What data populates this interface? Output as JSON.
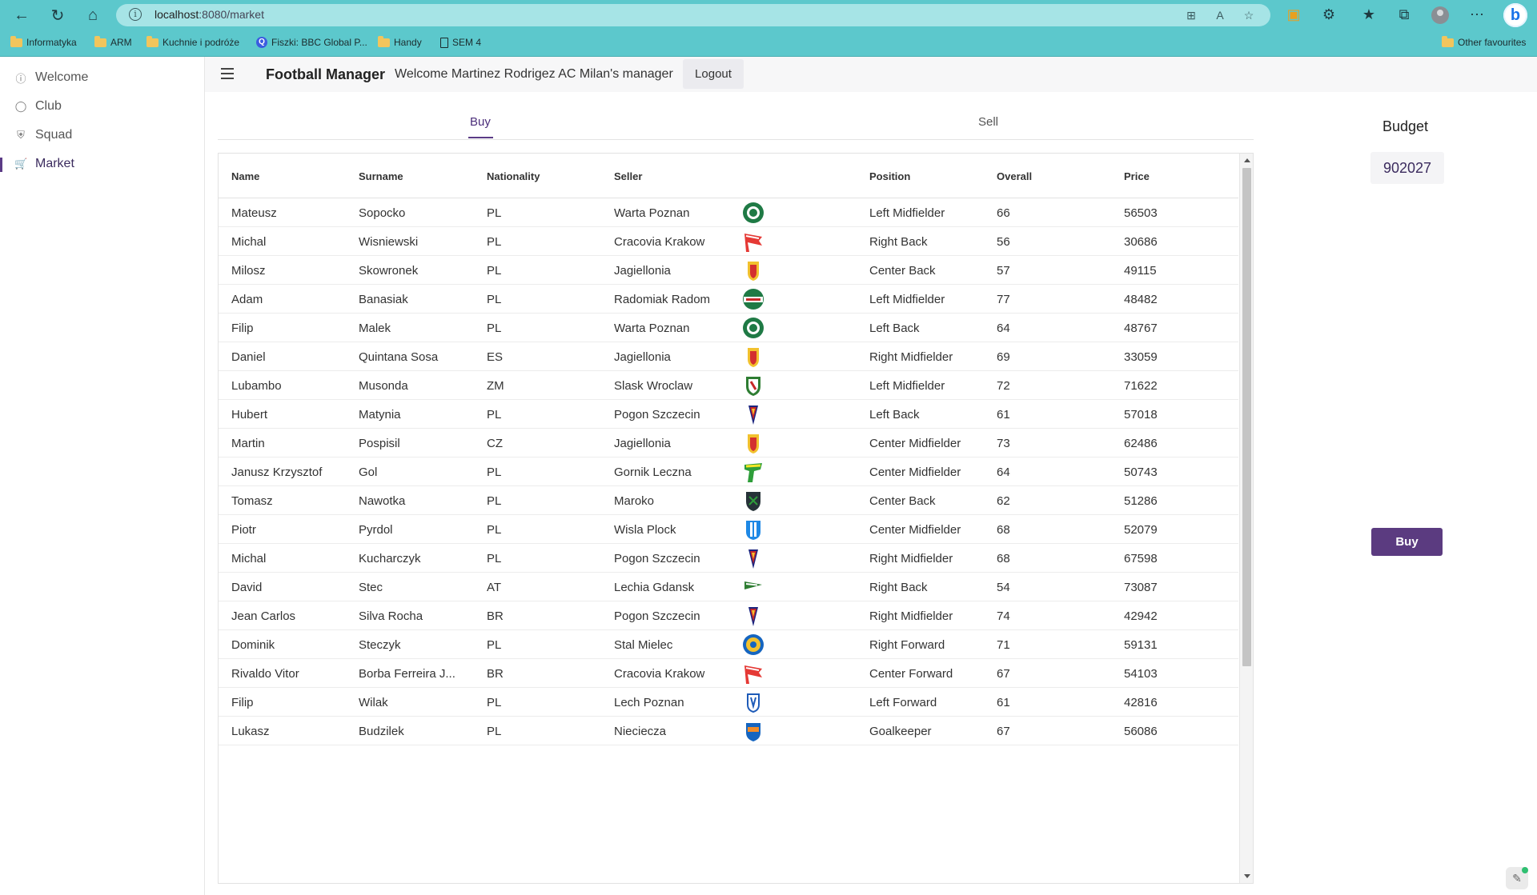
{
  "browser": {
    "url_host": "localhost",
    "url_path": ":8080/market",
    "bookmarks": [
      {
        "label": "Informatyka",
        "icon": "folder-icon"
      },
      {
        "label": "ARM",
        "icon": "folder-icon"
      },
      {
        "label": "Kuchnie i podróże",
        "icon": "folder-icon"
      },
      {
        "label": "Fiszki: BBC Global P...",
        "icon": "quizlet-icon"
      },
      {
        "label": "Handy",
        "icon": "folder-icon"
      },
      {
        "label": "SEM 4",
        "icon": "document-icon"
      }
    ],
    "other_favourites": "Other favourites",
    "colors": {
      "chrome": "#5cc8cc",
      "url_bar": "#a6e4e6"
    }
  },
  "sidebar": {
    "items": [
      {
        "label": "Welcome",
        "icon": "info-icon"
      },
      {
        "label": "Club",
        "icon": "lightbulb-icon"
      },
      {
        "label": "Squad",
        "icon": "shield-icon"
      },
      {
        "label": "Market",
        "icon": "cart-icon",
        "active": true
      }
    ]
  },
  "header": {
    "title": "Football Manager",
    "welcome": "Welcome Martinez Rodrigez AC Milan's manager",
    "logout": "Logout"
  },
  "tabs": {
    "buy": "Buy",
    "sell": "Sell",
    "active": "Buy"
  },
  "table": {
    "columns": [
      "Name",
      "Surname",
      "Nationality",
      "Seller",
      "Position",
      "Overall",
      "Price"
    ],
    "rows": [
      {
        "name": "Mateusz",
        "surname": "Sopocko",
        "nat": "PL",
        "seller": "Warta Poznan",
        "crest": "warta-crest-icon",
        "position": "Left Midfielder",
        "overall": "66",
        "price": "56503"
      },
      {
        "name": "Michal",
        "surname": "Wisniewski",
        "nat": "PL",
        "seller": "Cracovia Krakow",
        "crest": "cracovia-crest-icon",
        "position": "Right Back",
        "overall": "56",
        "price": "30686"
      },
      {
        "name": "Milosz",
        "surname": "Skowronek",
        "nat": "PL",
        "seller": "Jagiellonia",
        "crest": "jagiellonia-crest-icon",
        "position": "Center Back",
        "overall": "57",
        "price": "49115"
      },
      {
        "name": "Adam",
        "surname": "Banasiak",
        "nat": "PL",
        "seller": "Radomiak Radom",
        "crest": "radomiak-crest-icon",
        "position": "Left Midfielder",
        "overall": "77",
        "price": "48482"
      },
      {
        "name": "Filip",
        "surname": "Malek",
        "nat": "PL",
        "seller": "Warta Poznan",
        "crest": "warta-crest-icon",
        "position": "Left Back",
        "overall": "64",
        "price": "48767"
      },
      {
        "name": "Daniel",
        "surname": "Quintana Sosa",
        "nat": "ES",
        "seller": "Jagiellonia",
        "crest": "jagiellonia-crest-icon",
        "position": "Right Midfielder",
        "overall": "69",
        "price": "33059"
      },
      {
        "name": "Lubambo",
        "surname": "Musonda",
        "nat": "ZM",
        "seller": "Slask Wroclaw",
        "crest": "slask-crest-icon",
        "position": "Left Midfielder",
        "overall": "72",
        "price": "71622"
      },
      {
        "name": "Hubert",
        "surname": "Matynia",
        "nat": "PL",
        "seller": "Pogon Szczecin",
        "crest": "pogon-crest-icon",
        "position": "Left Back",
        "overall": "61",
        "price": "57018"
      },
      {
        "name": "Martin",
        "surname": "Pospisil",
        "nat": "CZ",
        "seller": "Jagiellonia",
        "crest": "jagiellonia-crest-icon",
        "position": "Center Midfielder",
        "overall": "73",
        "price": "62486"
      },
      {
        "name": "Janusz Krzysztof",
        "surname": "Gol",
        "nat": "PL",
        "seller": "Gornik Leczna",
        "crest": "gornik-leczna-crest-icon",
        "position": "Center Midfielder",
        "overall": "64",
        "price": "50743"
      },
      {
        "name": "Tomasz",
        "surname": "Nawotka",
        "nat": "PL",
        "seller": "Maroko",
        "crest": "maroko-crest-icon",
        "position": "Center Back",
        "overall": "62",
        "price": "51286"
      },
      {
        "name": "Piotr",
        "surname": "Pyrdol",
        "nat": "PL",
        "seller": "Wisla Plock",
        "crest": "wisla-plock-crest-icon",
        "position": "Center Midfielder",
        "overall": "68",
        "price": "52079"
      },
      {
        "name": "Michal",
        "surname": "Kucharczyk",
        "nat": "PL",
        "seller": "Pogon Szczecin",
        "crest": "pogon-crest-icon",
        "position": "Right Midfielder",
        "overall": "68",
        "price": "67598"
      },
      {
        "name": "David",
        "surname": "Stec",
        "nat": "AT",
        "seller": "Lechia Gdansk",
        "crest": "lechia-crest-icon",
        "position": "Right Back",
        "overall": "54",
        "price": "73087"
      },
      {
        "name": "Jean Carlos",
        "surname": "Silva Rocha",
        "nat": "BR",
        "seller": "Pogon Szczecin",
        "crest": "pogon-crest-icon",
        "position": "Right Midfielder",
        "overall": "74",
        "price": "42942"
      },
      {
        "name": "Dominik",
        "surname": "Steczyk",
        "nat": "PL",
        "seller": "Stal Mielec",
        "crest": "stal-mielec-crest-icon",
        "position": "Right Forward",
        "overall": "71",
        "price": "59131"
      },
      {
        "name": "Rivaldo Vitor",
        "surname": "Borba Ferreira J...",
        "nat": "BR",
        "seller": "Cracovia Krakow",
        "crest": "cracovia-crest-icon",
        "position": "Center Forward",
        "overall": "67",
        "price": "54103"
      },
      {
        "name": "Filip",
        "surname": "Wilak",
        "nat": "PL",
        "seller": "Lech Poznan",
        "crest": "lech-crest-icon",
        "position": "Left Forward",
        "overall": "61",
        "price": "42816"
      },
      {
        "name": "Lukasz",
        "surname": "Budzilek",
        "nat": "PL",
        "seller": "Niecieczа",
        "crest": "nieciecza-crest-icon",
        "position": "Goalkeeper",
        "overall": "67",
        "price": "56086"
      }
    ]
  },
  "budget": {
    "title": "Budget",
    "value": "902027"
  },
  "buy_button": "Buy",
  "colors": {
    "accent": "#5b3b86"
  }
}
